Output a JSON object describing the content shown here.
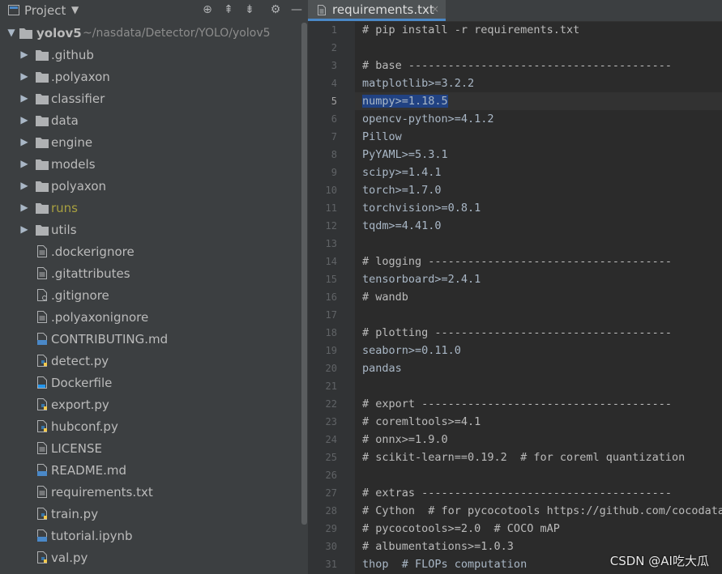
{
  "project_panel": {
    "title": "Project",
    "root": {
      "name": "yolov5",
      "path": "~/nasdata/Detector/YOLO/yolov5"
    },
    "folders": [
      {
        "name": ".github",
        "color": "#bbbbbb"
      },
      {
        "name": ".polyaxon",
        "color": "#bbbbbb"
      },
      {
        "name": "classifier",
        "color": "#bbbbbb"
      },
      {
        "name": "data",
        "color": "#bbbbbb"
      },
      {
        "name": "engine",
        "color": "#bbbbbb"
      },
      {
        "name": "models",
        "color": "#bbbbbb"
      },
      {
        "name": "polyaxon",
        "color": "#bbbbbb"
      },
      {
        "name": "runs",
        "color": "#a8a040"
      },
      {
        "name": "utils",
        "color": "#bbbbbb"
      }
    ],
    "files": [
      {
        "name": ".dockerignore",
        "icon": "text-file-icon"
      },
      {
        "name": ".gitattributes",
        "icon": "text-file-icon"
      },
      {
        "name": ".gitignore",
        "icon": "gitignore-file-icon"
      },
      {
        "name": ".polyaxonignore",
        "icon": "text-file-icon"
      },
      {
        "name": "CONTRIBUTING.md",
        "icon": "markdown-file-icon"
      },
      {
        "name": "detect.py",
        "icon": "python-file-icon"
      },
      {
        "name": "Dockerfile",
        "icon": "docker-file-icon"
      },
      {
        "name": "export.py",
        "icon": "python-file-icon"
      },
      {
        "name": "hubconf.py",
        "icon": "python-file-icon"
      },
      {
        "name": "LICENSE",
        "icon": "text-file-icon"
      },
      {
        "name": "README.md",
        "icon": "markdown-file-icon"
      },
      {
        "name": "requirements.txt",
        "icon": "text-file-icon"
      },
      {
        "name": "train.py",
        "icon": "python-file-icon"
      },
      {
        "name": "tutorial.ipynb",
        "icon": "notebook-file-icon"
      },
      {
        "name": "val.py",
        "icon": "python-file-icon"
      }
    ]
  },
  "editor": {
    "tab": {
      "label": "requirements.txt",
      "close": "×"
    },
    "current_line": 5,
    "selected_text": "numpy>=1.18.5",
    "lines": [
      "# pip install -r requirements.txt",
      "",
      "# base ----------------------------------------",
      "matplotlib>=3.2.2",
      "numpy>=1.18.5",
      "opencv-python>=4.1.2",
      "Pillow",
      "PyYAML>=5.3.1",
      "scipy>=1.4.1",
      "torch>=1.7.0",
      "torchvision>=0.8.1",
      "tqdm>=4.41.0",
      "",
      "# logging -------------------------------------",
      "tensorboard>=2.4.1",
      "# wandb",
      "",
      "# plotting ------------------------------------",
      "seaborn>=0.11.0",
      "pandas",
      "",
      "# export --------------------------------------",
      "# coremltools>=4.1",
      "# onnx>=1.9.0",
      "# scikit-learn==0.19.2  # for coreml quantization",
      "",
      "# extras --------------------------------------",
      "# Cython  # for pycocotools https://github.com/cocodatas",
      "# pycocotools>=2.0  # COCO mAP",
      "# albumentations>=1.0.3",
      "thop  # FLOPs computation"
    ]
  },
  "watermark": "CSDN @AI吃大瓜",
  "colors": {
    "accent": "#4a88c7",
    "selection": "#214283",
    "panel": "#3c3f41",
    "editor": "#2b2b2b"
  }
}
